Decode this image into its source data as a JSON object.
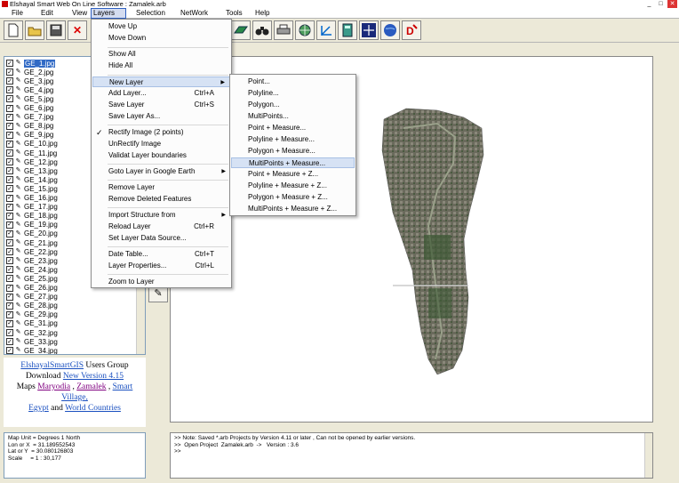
{
  "window": {
    "title": "Elshayal Smart Web On Line Software : Zamalek.arb",
    "controls": [
      "_",
      "□",
      "✕"
    ]
  },
  "menubar": [
    "File",
    "Edit",
    "View",
    "Layers",
    "Selection",
    "NetWork",
    "Tools",
    "Help"
  ],
  "layers_menu": {
    "items": [
      {
        "label": "Move Up"
      },
      {
        "label": "Move Down"
      },
      {
        "label": "Show All"
      },
      {
        "label": "Hide All"
      },
      {
        "label": "New Layer"
      },
      {
        "label": "Add Layer...",
        "shortcut": "Ctrl+A"
      },
      {
        "label": "Save Layer",
        "shortcut": "Ctrl+S"
      },
      {
        "label": "Save Layer As..."
      },
      {
        "label": "Rectify Image (2 points)"
      },
      {
        "label": "UnRectify Image"
      },
      {
        "label": "Validat Layer boundaries"
      },
      {
        "label": "Goto Layer in Google Earth"
      },
      {
        "label": "Remove Layer"
      },
      {
        "label": "Remove Deleted Features"
      },
      {
        "label": "Import Structure from"
      },
      {
        "label": "Reload Layer",
        "shortcut": "Ctrl+R"
      },
      {
        "label": "Set Layer Data Source..."
      },
      {
        "label": "Date Table...",
        "shortcut": "Ctrl+T"
      },
      {
        "label": "Layer Properties...",
        "shortcut": "Ctrl+L"
      },
      {
        "label": "Zoom to Layer"
      }
    ]
  },
  "new_layer_submenu": [
    "Point...",
    "Polyline...",
    "Polygon...",
    "MultiPoints...",
    "Point + Measure...",
    "Polyline + Measure...",
    "Polygon + Measure...",
    "MultiPoints + Measure...",
    "Point + Measure + Z...",
    "Polyline + Measure + Z...",
    "Polygon + Measure + Z...",
    "MultiPoints + Measure + Z..."
  ],
  "layers": [
    "GE_1.jpg",
    "GE_2.jpg",
    "GE_3.jpg",
    "GE_4.jpg",
    "GE_5.jpg",
    "GE_6.jpg",
    "GE_7.jpg",
    "GE_8.jpg",
    "GE_9.jpg",
    "GE_10.jpg",
    "GE_11.jpg",
    "GE_12.jpg",
    "GE_13.jpg",
    "GE_14.jpg",
    "GE_15.jpg",
    "GE_16.jpg",
    "GE_17.jpg",
    "GE_18.jpg",
    "GE_19.jpg",
    "GE_20.jpg",
    "GE_21.jpg",
    "GE_22.jpg",
    "GE_23.jpg",
    "GE_24.jpg",
    "GE_25.jpg",
    "GE_26.jpg",
    "GE_27.jpg",
    "GE_28.jpg",
    "GE_29.jpg",
    "GE_31.jpg",
    "GE_32.jpg",
    "GE_33.jpg",
    "GE_34.jpg"
  ],
  "links": {
    "group_link": "ElshayalSmartGIS",
    "group_text": " Users Group",
    "download_text": "Download ",
    "download_link": "New Version 4.15",
    "maps_text": "Maps ",
    "map_maryodia": "Maryodia",
    "sep1": " , ",
    "map_zamalek": "Zamalek",
    "sep2": " , ",
    "map_smart_village": "Smart Village,",
    "map_egypt": "Egypt",
    "and_text": " and ",
    "map_world": "World Countries"
  },
  "info": {
    "map_unit": "Map Unit = Degrees 1 North",
    "lon": "Lon or X  = 31.189552543",
    "lat": "Lat or Y  = 30.080126803",
    "scale": "Scale     = 1 : 30,177"
  },
  "console": {
    "line1": ">>  Note: Saved *.arb Projects by Version 4.11 or later , Can not be opened by earlier versions.",
    "line2": ">>  Open Project  Zamalek.arb  ->   Version : 3.6",
    "line3": ">>"
  },
  "colors": {
    "selection": "#316ac5",
    "menu_highlight": "#d6e2f4",
    "link": "#1a50c0",
    "visited_link": "#800080"
  },
  "icons": [
    "new-file-icon",
    "open-folder-icon",
    "save-disk-icon",
    "delete-x-icon",
    "eraser-icon",
    "binoculars-icon",
    "printer-icon",
    "globe-layers-icon",
    "axis-icon",
    "calculator-icon",
    "star-sparkle-icon",
    "earth-icon",
    "pdf-icon",
    "pencil-icon"
  ]
}
